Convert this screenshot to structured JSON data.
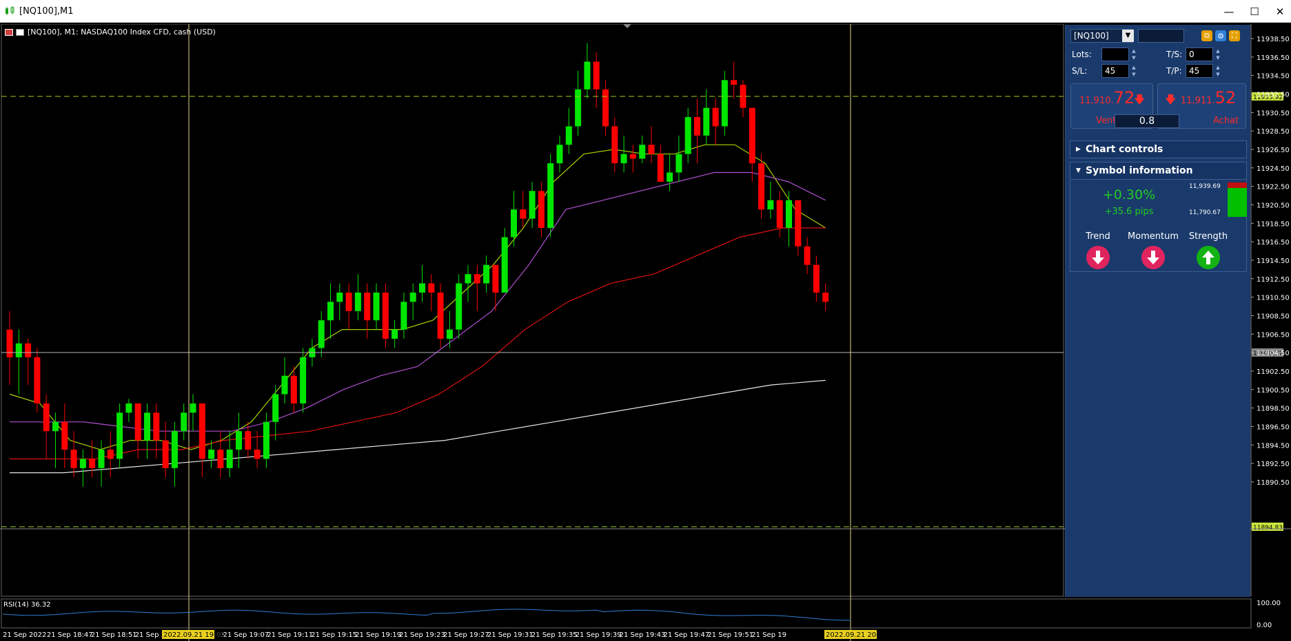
{
  "window": {
    "title": "[NQ100],M1"
  },
  "chart": {
    "header": "[NQ100], M1:  NASDAQ100 Index CFD, cash (USD)",
    "price_axis": [
      "11938.50",
      "11936.50",
      "11934.50",
      "11932.50",
      "11930.50",
      "11928.50",
      "11926.50",
      "11924.50",
      "11922.50",
      "11920.50",
      "11918.50",
      "11916.50",
      "11914.50",
      "11912.50",
      "11910.50",
      "11908.50",
      "11906.50",
      "11904.50",
      "11902.50",
      "11900.50",
      "11898.50",
      "11896.50",
      "11894.50",
      "11892.50",
      "11890.50"
    ],
    "hline_upper_label": "11933.92",
    "hline_lower_label": "11894.83",
    "current_price_label": "11910.72",
    "time_axis": [
      "21 Sep 2022",
      "21 Sep 18:47",
      "21 Sep 18:51",
      "21 Sep 18",
      "21 Sep 19:03",
      "21 Sep 19:07",
      "21 Sep 19:11",
      "21 Sep 19:15",
      "21 Sep 19:19",
      "21 Sep 19:23",
      "21 Sep 19:27",
      "21 Sep 19:31",
      "21 Sep 19:35",
      "21 Sep 19:39",
      "21 Sep 19:43",
      "21 Sep 19:47",
      "21 Sep 19:51",
      "21 Sep 19"
    ],
    "time_marker_left": "2022.09.21 19:00",
    "time_marker_right": "2022.09.21 20:00",
    "rsi_label": "RSI(14) 36.32",
    "rsi_axis": [
      "100.00",
      "0.00"
    ],
    "colors": {
      "bull": "#00e600",
      "bear": "#ff0000",
      "ma_fast": "#a8d400",
      "ma_mid": "#b050d0",
      "ma_slow": "#e01010",
      "ma_long": "#e8e8e8",
      "grid_line": "#b2d234",
      "rsi": "#2f7fd6"
    }
  },
  "panel": {
    "symbol": "[NQ100]",
    "lots_label": "Lots:",
    "lots_value": "",
    "ts_label": "T/S:",
    "ts_value": "0",
    "sl_label": "S/L:",
    "sl_value": "45",
    "tp_label": "T/P:",
    "tp_value": "45",
    "sell_price_main": "11,910.",
    "sell_price_big": "72",
    "buy_price_main": "11,911.",
    "buy_price_big": "52",
    "sell_label": "Vente",
    "buy_label": "Achat",
    "spread": "0.8",
    "chart_controls": "Chart controls",
    "symbol_information": "Symbol information",
    "change_pct": "+0.30%",
    "change_pips": "+35.6 pips",
    "range_high": "11,939.69",
    "range_low": "11,790.67",
    "trend_label": "Trend",
    "momentum_label": "Momentum",
    "strength_label": "Strength"
  }
}
